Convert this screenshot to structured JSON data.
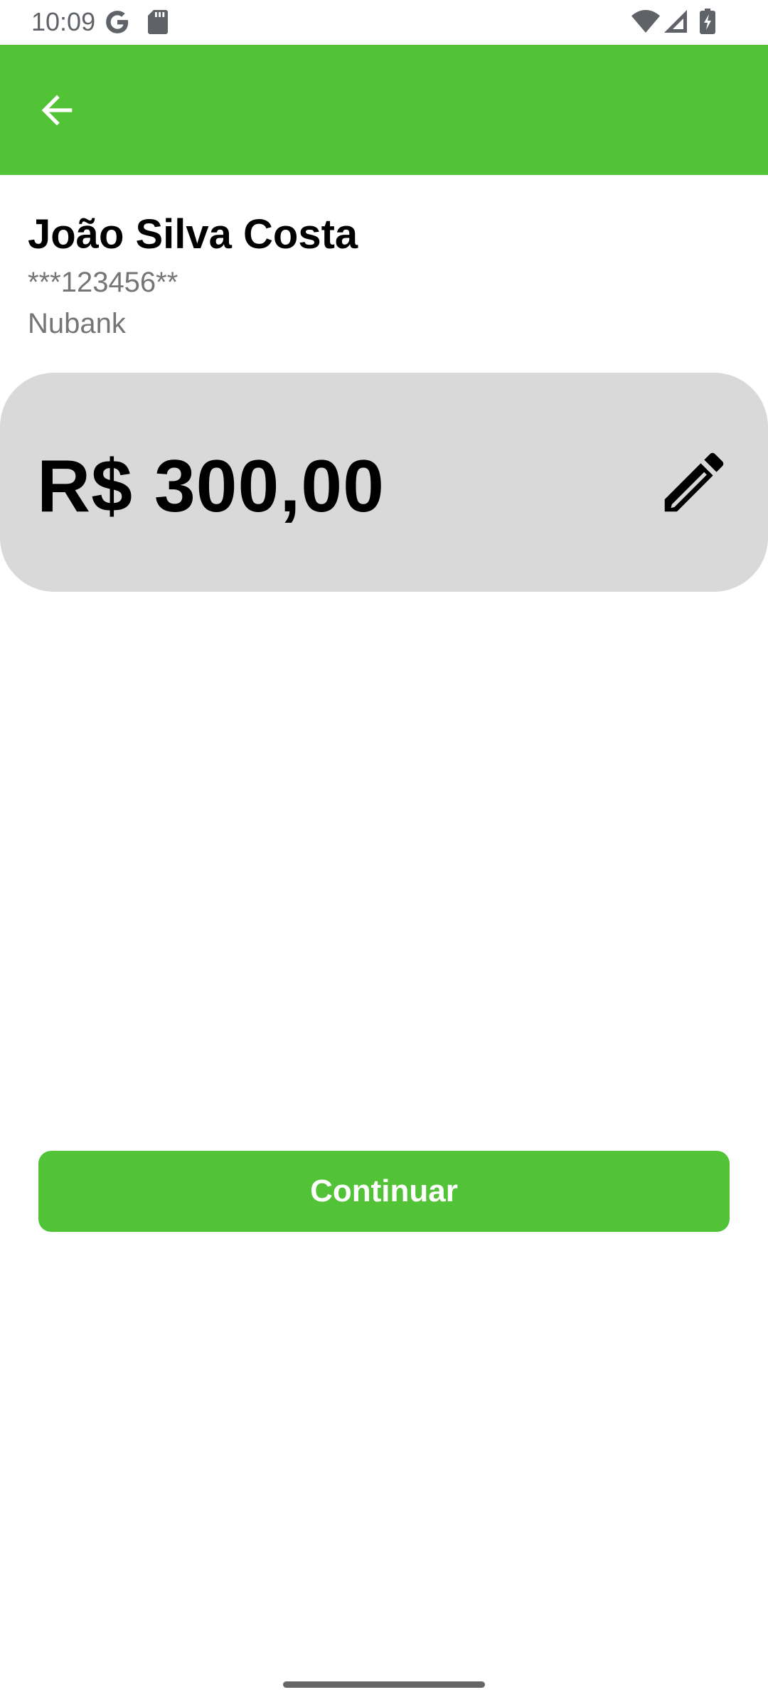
{
  "status_bar": {
    "time": "10:09",
    "icons": [
      "google-icon",
      "sd-card-icon",
      "wifi-icon",
      "signal-icon",
      "battery-charging-icon"
    ]
  },
  "app_bar": {
    "back_icon": "arrow-back-icon",
    "color": "#52c337"
  },
  "recipient": {
    "name": "João Silva Costa",
    "document": "***123456**",
    "bank": "Nubank"
  },
  "amount": {
    "value": "R$ 300,00",
    "edit_icon": "pencil-icon",
    "card_color": "#d9d9d9"
  },
  "actions": {
    "continue_label": "Continuar",
    "button_color": "#52c337"
  }
}
